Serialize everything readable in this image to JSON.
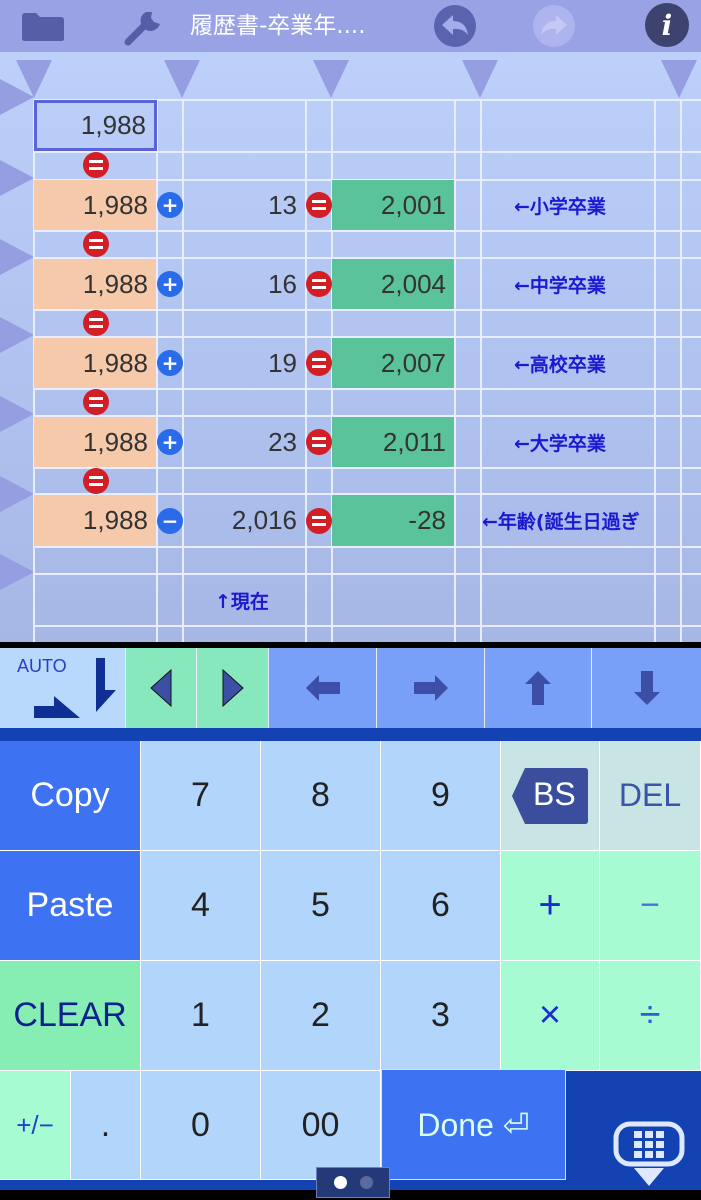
{
  "header": {
    "title": "履歴書-卒業年....",
    "icons": [
      "folder-icon",
      "wrench-icon",
      "undo-icon",
      "redo-icon",
      "info-icon"
    ],
    "redo_enabled": false
  },
  "sheet": {
    "selected_cell": "1,988",
    "rows": [
      {
        "a": "1,988",
        "op1": "+",
        "b": "13",
        "op2": "=",
        "result": "2,001",
        "note": "←小学卒業"
      },
      {
        "a": "1,988",
        "op1": "+",
        "b": "16",
        "op2": "=",
        "result": "2,004",
        "note": "←中学卒業"
      },
      {
        "a": "1,988",
        "op1": "+",
        "b": "19",
        "op2": "=",
        "result": "2,007",
        "note": "←高校卒業"
      },
      {
        "a": "1,988",
        "op1": "+",
        "b": "23",
        "op2": "=",
        "result": "2,011",
        "note": "←大学卒業"
      },
      {
        "a": "1,988",
        "op1": "−",
        "b": "2,016",
        "op2": "=",
        "result": "-28",
        "note": "←年齢(誕生日過ぎ"
      }
    ],
    "footnote": "↑現在",
    "colors": {
      "input": "#f6c9aa",
      "result": "#5bc39a",
      "note": "#1a1ad0"
    }
  },
  "nav": {
    "auto_label": "AUTO",
    "buttons": [
      "auto-direction",
      "prev",
      "next",
      "left",
      "right",
      "up",
      "down"
    ]
  },
  "keypad": {
    "copy": "Copy",
    "paste": "Paste",
    "clear": "CLEAR",
    "digits_row1": [
      "7",
      "8",
      "9"
    ],
    "digits_row2": [
      "4",
      "5",
      "6"
    ],
    "digits_row3": [
      "1",
      "2",
      "3"
    ],
    "bs": "BS",
    "del": "DEL",
    "plus": "+",
    "minus": "−",
    "times": "×",
    "divide": "÷",
    "plusminus": "+/−",
    "dot": ".",
    "zero": "0",
    "double_zero": "00",
    "done": "Done ⏎",
    "page": {
      "current": 1,
      "total": 2
    }
  }
}
